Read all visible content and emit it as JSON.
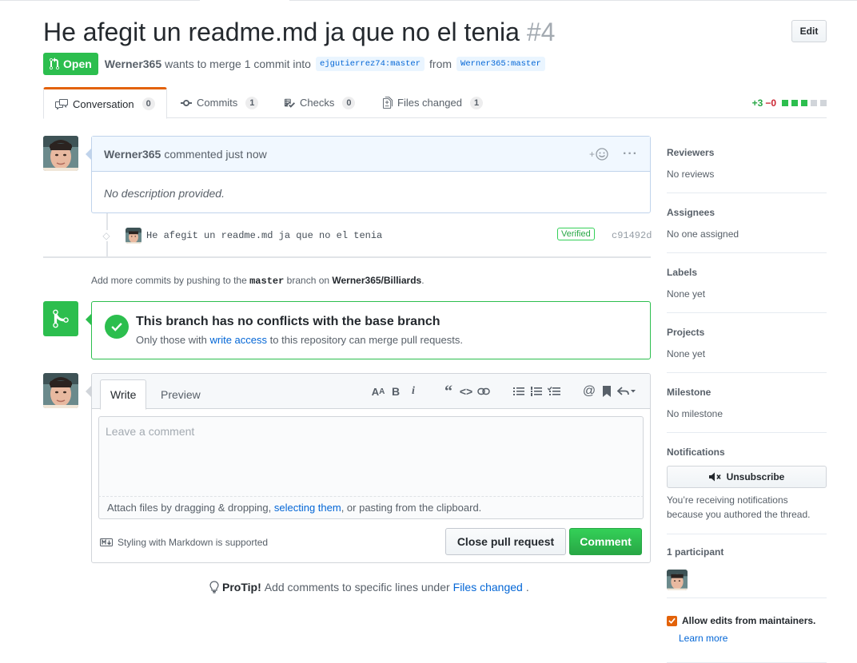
{
  "pr": {
    "title": "He afegit un readme.md ja que no el tenia",
    "number": "#4",
    "edit_label": "Edit",
    "state": "Open",
    "author": "Werner365",
    "merge_text": "wants to merge 1 commit into",
    "base_branch": "ejgutierrez74:master",
    "from_text": "from",
    "head_branch": "Werner365:master"
  },
  "tabs": [
    {
      "label": "Conversation",
      "count": "0",
      "icon": "comment-discussion-icon"
    },
    {
      "label": "Commits",
      "count": "1",
      "icon": "git-commit-icon"
    },
    {
      "label": "Checks",
      "count": "0",
      "icon": "checklist-icon"
    },
    {
      "label": "Files changed",
      "count": "1",
      "icon": "file-diff-icon"
    }
  ],
  "diffstat": {
    "added": "+3",
    "removed": "−0",
    "colors": {
      "add": "#2cbe4e",
      "neutral": "#d1d5da"
    }
  },
  "comment": {
    "author": "Werner365",
    "action": "commented just now",
    "body": "No description provided."
  },
  "commit": {
    "message": "He afegit un readme.md ja que no el tenia",
    "verified": "Verified",
    "sha": "c91492d"
  },
  "push_hint": {
    "prefix": "Add more commits by pushing to the",
    "branch": "master",
    "middle": "branch on",
    "repo": "Werner365/Billiards",
    "suffix": "."
  },
  "merge": {
    "title": "This branch has no conflicts with the base branch",
    "sub_prefix": "Only those with",
    "sub_link": "write access",
    "sub_suffix": "to this repository can merge pull requests."
  },
  "form": {
    "write_tab": "Write",
    "preview_tab": "Preview",
    "placeholder": "Leave a comment",
    "attach_prefix": "Attach files by dragging & dropping,",
    "attach_link": "selecting them",
    "attach_suffix": ", or pasting from the clipboard.",
    "markdown_note": "Styling with Markdown is supported",
    "close_button": "Close pull request",
    "comment_button": "Comment"
  },
  "protip": {
    "label": "ProTip!",
    "text": "Add comments to specific lines under",
    "link": "Files changed",
    "suffix": "."
  },
  "sidebar": {
    "reviewers": {
      "title": "Reviewers",
      "value": "No reviews"
    },
    "assignees": {
      "title": "Assignees",
      "value": "No one assigned"
    },
    "labels": {
      "title": "Labels",
      "value": "None yet"
    },
    "projects": {
      "title": "Projects",
      "value": "None yet"
    },
    "milestone": {
      "title": "Milestone",
      "value": "No milestone"
    },
    "notifications": {
      "title": "Notifications",
      "button": "Unsubscribe",
      "note": "You’re receiving notifications because you authored the thread."
    },
    "participants": {
      "title": "1 participant"
    },
    "maintainers": {
      "label": "Allow edits from maintainers.",
      "link": "Learn more"
    }
  },
  "colors": {
    "accent": "#0366d6",
    "green": "#2cbe4e",
    "orange": "#e36209"
  }
}
